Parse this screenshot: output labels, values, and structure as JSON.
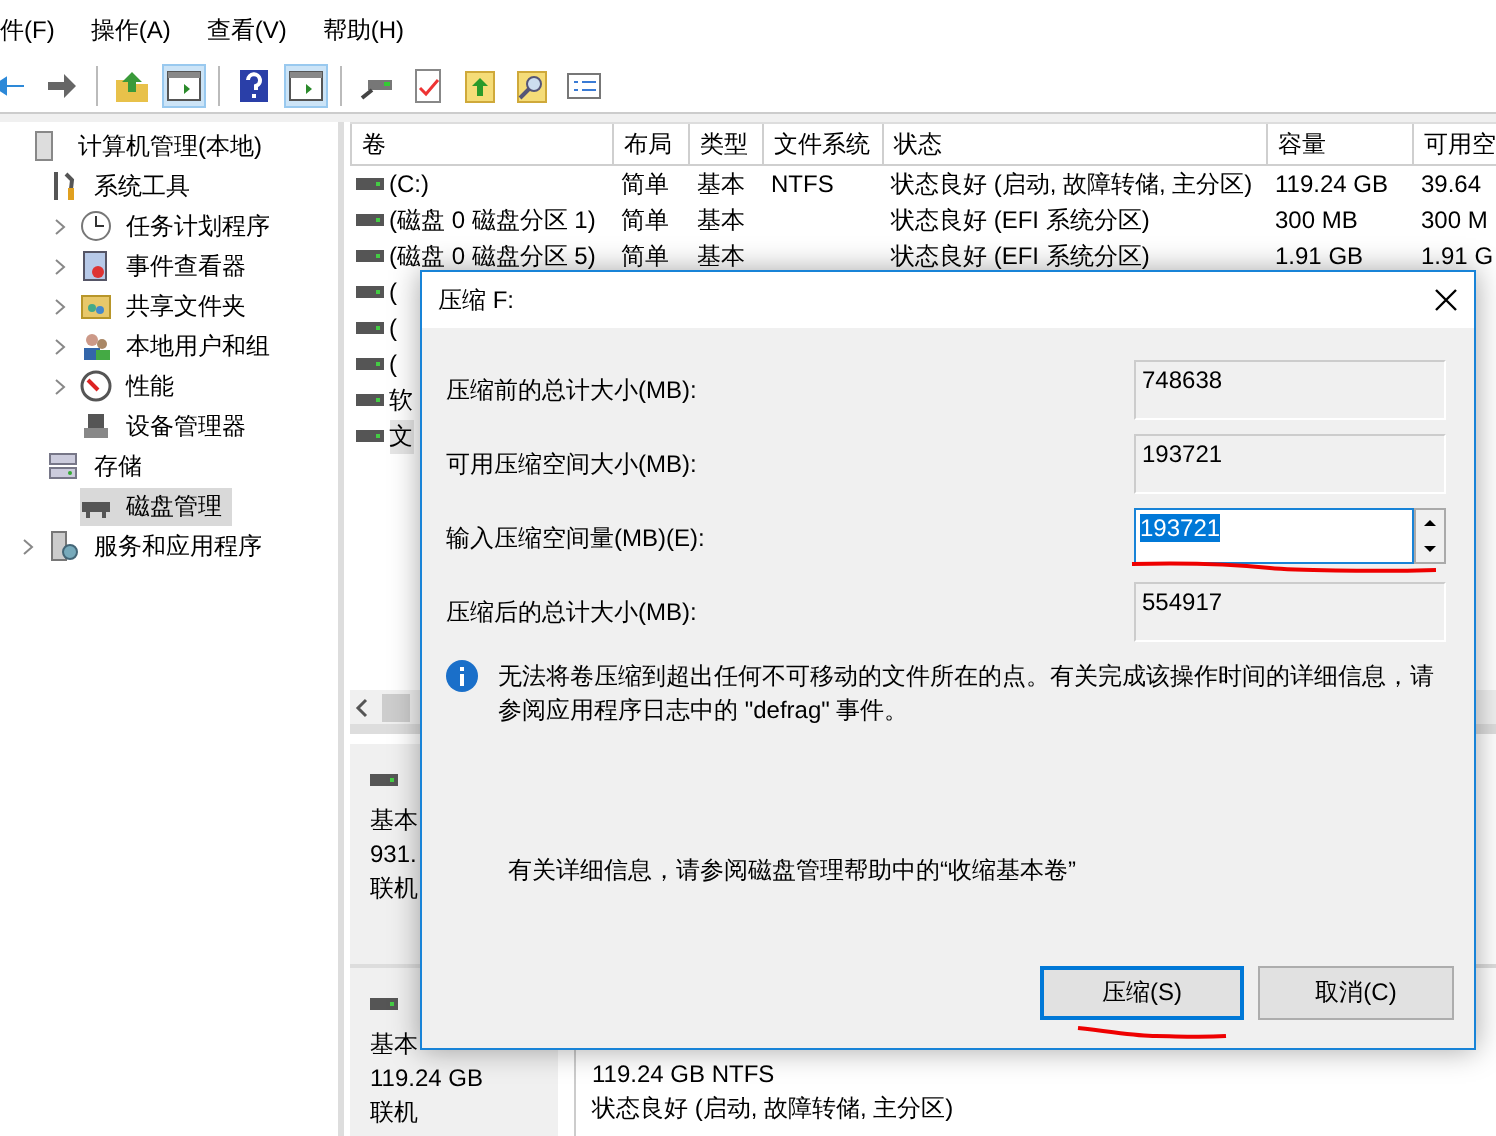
{
  "menu": [
    {
      "label": "件(F)"
    },
    {
      "label": "操作(A)"
    },
    {
      "label": "查看(V)"
    },
    {
      "label": "帮助(H)"
    }
  ],
  "toolbar": [
    {
      "kind": "back",
      "selected": false
    },
    {
      "kind": "forward",
      "selected": false
    },
    {
      "kind": "up",
      "selected": false
    },
    {
      "kind": "pane",
      "selected": true
    },
    {
      "kind": "help",
      "selected": false
    },
    {
      "kind": "pane",
      "selected": true
    },
    {
      "kind": "connect",
      "selected": false
    },
    {
      "kind": "check",
      "selected": false
    },
    {
      "kind": "export",
      "selected": false
    },
    {
      "kind": "find",
      "selected": false
    },
    {
      "kind": "list",
      "selected": false
    }
  ],
  "tree": [
    {
      "label": "计算机管理(本地)",
      "kind": "computer",
      "selected": false,
      "expanded": true,
      "children": [
        {
          "label": "系统工具",
          "kind": "tools",
          "selected": false,
          "expanded": true,
          "children": [
            {
              "label": "任务计划程序",
              "kind": "clock",
              "selected": false,
              "expanded": false
            },
            {
              "label": "事件查看器",
              "kind": "log",
              "selected": false,
              "expanded": false
            },
            {
              "label": "共享文件夹",
              "kind": "share",
              "selected": false,
              "expanded": false
            },
            {
              "label": "本地用户和组",
              "kind": "users",
              "selected": false,
              "expanded": false
            },
            {
              "label": "性能",
              "kind": "gauge",
              "selected": false,
              "expanded": false
            },
            {
              "label": "设备管理器",
              "kind": "device",
              "selected": false
            }
          ]
        },
        {
          "label": "存储",
          "kind": "storage",
          "selected": false,
          "expanded": true,
          "children": [
            {
              "label": "磁盘管理",
              "kind": "disk",
              "selected": true
            }
          ]
        },
        {
          "label": "服务和应用程序",
          "kind": "services",
          "selected": false,
          "expanded": false
        }
      ]
    }
  ],
  "table": {
    "columns": [
      "卷",
      "布局",
      "类型",
      "文件系统",
      "状态",
      "容量",
      "可用空"
    ],
    "rows": [
      {
        "selected": false,
        "cells": [
          "(C:)",
          "简单",
          "基本",
          "NTFS",
          "状态良好 (启动, 故障转储, 主分区)",
          "119.24 GB",
          "39.64"
        ]
      },
      {
        "selected": false,
        "cells": [
          "(磁盘 0 磁盘分区 1)",
          "简单",
          "基本",
          "",
          "状态良好 (EFI 系统分区)",
          "300 MB",
          "300 M"
        ]
      },
      {
        "selected": false,
        "cells": [
          "(磁盘 0 磁盘分区 5)",
          "简单",
          "基本",
          "",
          "状态良好 (EFI 系统分区)",
          "1.91 GB",
          "1.91 G"
        ]
      },
      {
        "selected": false,
        "cells": [
          "("
        ]
      },
      {
        "selected": false,
        "cells": [
          "("
        ]
      },
      {
        "selected": false,
        "cells": [
          "("
        ]
      },
      {
        "selected": false,
        "cells": [
          "软"
        ]
      },
      {
        "selected": true,
        "cells": [
          "文"
        ]
      }
    ]
  },
  "disks": [
    {
      "lines": [
        "基本",
        "931.",
        "联机"
      ]
    },
    {
      "lines": [
        "基本",
        "119.24 GB",
        "联机"
      ],
      "partition": [
        "119.24 GB NTFS",
        "状态良好 (启动, 故障转储, 主分区)"
      ]
    }
  ],
  "dialog": {
    "title": "压缩 F:",
    "fields": [
      {
        "label": "压缩前的总计大小(MB):",
        "value": "748638",
        "kind": "readonly"
      },
      {
        "label": "可用压缩空间大小(MB):",
        "value": "193721",
        "kind": "readonly"
      },
      {
        "label": "输入压缩空间量(MB)(E):",
        "value": "193721",
        "kind": "spin"
      },
      {
        "label": "压缩后的总计大小(MB):",
        "value": "554917",
        "kind": "readonly"
      }
    ],
    "info": "无法将卷压缩到超出任何不可移动的文件所在的点。有关完成该操作时间的详细信息，请参阅应用程序日志中的 \"defrag\" 事件。",
    "help": "有关详细信息，请参阅磁盘管理帮助中的“收缩基本卷”",
    "buttons": [
      {
        "label": "压缩(S)",
        "default": true
      },
      {
        "label": "取消(C)",
        "default": false
      }
    ]
  }
}
